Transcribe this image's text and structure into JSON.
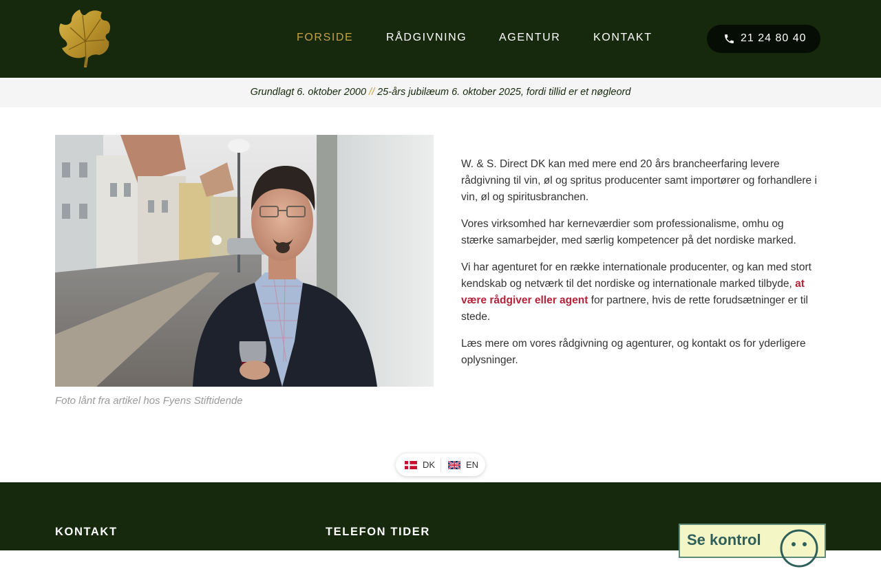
{
  "header": {
    "logo_icon": "grape-leaf-icon",
    "nav": [
      {
        "label": "FORSIDE",
        "active": true
      },
      {
        "label": "RÅDGIVNING",
        "active": false
      },
      {
        "label": "AGENTUR",
        "active": false
      },
      {
        "label": "KONTAKT",
        "active": false
      }
    ],
    "phone": {
      "icon": "phone-icon",
      "number": "21 24 80 40"
    }
  },
  "tagline": {
    "part1": "Grundlagt 6. oktober 2000",
    "separator": "//",
    "part2": "25-års jubilæum 6. oktober 2025, fordi tillid er et nøgleord"
  },
  "photo": {
    "caption": "Foto lånt fra artikel hos Fyens Stiftidende"
  },
  "content": {
    "p1": "W. & S. Direct DK kan med mere end 20 års brancheerfaring levere rådgivning til vin, øl og spritus producenter samt importører og forhandlere i vin, øl og spiritusbranchen.",
    "p2": "Vores virksomhed har kerneværdier som professionalisme, omhu og stærke samarbejder, med særlig kompetencer på det nordiske marked.",
    "p3_before": "Vi har agenturet for en række internationale producenter, og kan med stort kendskab og netværk til det nordiske og internationale marked tilbyde, ",
    "p3_link": "at være rådgiver eller agent",
    "p3_after": " for partnere, hvis de rette forudsætninger er til stede.",
    "p4": "Læs mere om vores rådgivning og agenturer, og kontakt os for yderligere oplysninger."
  },
  "language": {
    "items": [
      {
        "code": "DK",
        "icon": "danish-flag-icon"
      },
      {
        "code": "EN",
        "icon": "uk-flag-icon"
      }
    ]
  },
  "footer": {
    "contact_heading": "KONTAKT",
    "phone_hours_heading": "TELEFON TIDER",
    "badge_text": "Se kontrol"
  },
  "colors": {
    "header_bg": "#16290d",
    "gold_accent": "#c7a23f",
    "link_red": "#b5223a",
    "tagline_bg": "#f5f5f5"
  }
}
